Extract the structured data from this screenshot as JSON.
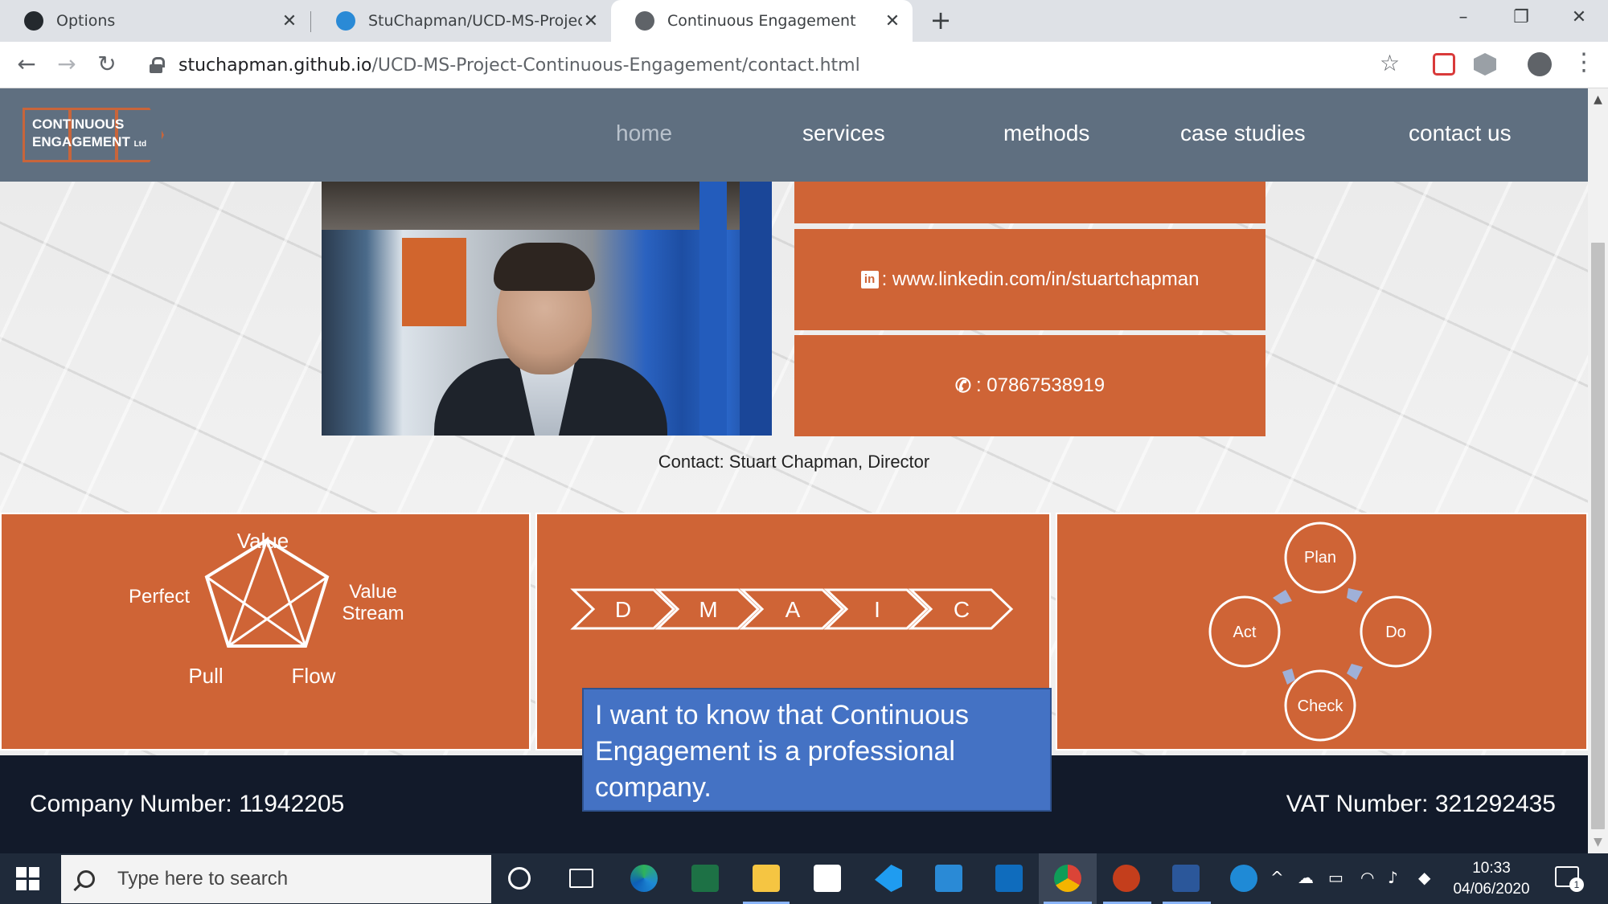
{
  "browser": {
    "tabs": [
      {
        "title": "Options",
        "icon": "github-icon"
      },
      {
        "title": "StuChapman/UCD-MS-Project-C",
        "icon": "codebase-icon"
      },
      {
        "title": "Continuous Engagement",
        "icon": "globe-icon"
      }
    ],
    "new_tab": "+",
    "window_controls": {
      "minimize": "–",
      "restore": "❐",
      "close": "✕"
    },
    "nav": {
      "back": "←",
      "forward": "→",
      "reload": "↻"
    },
    "url": {
      "host": "stuchapman.github.io",
      "path": "/UCD-MS-Project-Continuous-Engagement/contact.html"
    },
    "bookmark_star": "☆",
    "menu": "⋮"
  },
  "site": {
    "logo": {
      "line1": "CONTINUOUS",
      "line2": "ENGAGEMENT",
      "suffix": "Ltd"
    },
    "nav": [
      {
        "label": "home",
        "current": true
      },
      {
        "label": "services",
        "current": false
      },
      {
        "label": "methods",
        "current": false
      },
      {
        "label": "case studies",
        "current": false
      },
      {
        "label": "contact us",
        "current": false
      }
    ],
    "contact_cards": [
      {
        "icon": "linkedin-icon",
        "text": ": www.linkedin.com/in/stuartchapman"
      },
      {
        "icon": "phone-icon",
        "text": ": 07867538919"
      }
    ],
    "caption": "Contact: Stuart Chapman, Director",
    "lean": {
      "top": "Value",
      "left": "Perfect",
      "right1": "Value",
      "right2": "Stream",
      "bottom_left": "Pull",
      "bottom_right": "Flow"
    },
    "dmaic": [
      "D",
      "M",
      "A",
      "I",
      "C"
    ],
    "pdca": {
      "top": "Plan",
      "right": "Do",
      "bottom": "Check",
      "left": "Act"
    },
    "footer": {
      "company": "Company Number: 11942205",
      "vat": "VAT Number: 321292435"
    },
    "callout": "I want to know that Continuous Engagement is a professional company."
  },
  "taskbar": {
    "search_placeholder": "Type here to search",
    "time": "10:33",
    "date": "04/06/2020",
    "notification_count": "1"
  },
  "colors": {
    "accent_orange": "#cf6436",
    "nav_bg": "#5f6f80",
    "footer_bg": "#121a2a",
    "callout_blue": "#4472c4"
  }
}
